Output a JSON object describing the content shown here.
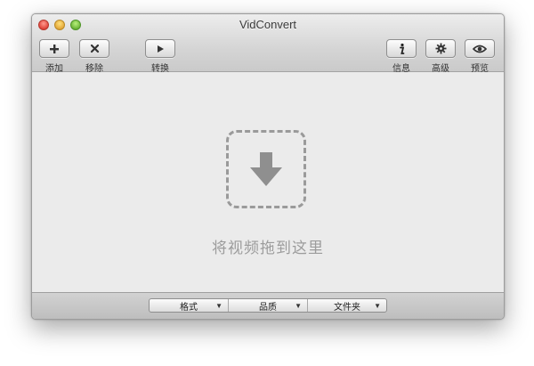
{
  "window": {
    "title": "VidConvert"
  },
  "toolbar": {
    "add_label": "添加",
    "remove_label": "移除",
    "convert_label": "转换",
    "info_label": "信息",
    "advanced_label": "高级",
    "preview_label": "预览"
  },
  "dropzone": {
    "text": "将视频拖到这里"
  },
  "bottom": {
    "format_label": "格式",
    "quality_label": "品质",
    "folder_label": "文件夹"
  },
  "icons": {
    "add": "plus-icon",
    "remove": "x-icon",
    "convert": "play-icon",
    "info": "info-icon",
    "advanced": "gear-icon",
    "preview": "eye-icon",
    "drop": "download-arrow-icon",
    "dropdown": "triangle-down-icon"
  },
  "colors": {
    "window_bg": "#ebebeb",
    "dashed_border": "#9a9a9a",
    "drop_text": "#9c9c9c"
  }
}
